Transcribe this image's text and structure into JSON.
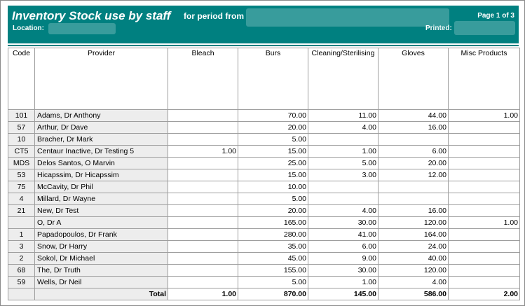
{
  "header": {
    "title": "Inventory Stock use by staff",
    "period_label": "for period from",
    "page_label": "Page 1 of 3",
    "location_label": "Location:",
    "printed_label": "Printed:"
  },
  "table": {
    "columns": [
      "Code",
      "Provider",
      "Bleach",
      "Burs",
      "Cleaning/Sterilising",
      "Gloves",
      "Misc Products"
    ],
    "rows": [
      {
        "code": "101",
        "provider": "Adams, Dr Anthony",
        "bleach": "",
        "burs": "70.00",
        "cleaning": "11.00",
        "gloves": "44.00",
        "misc": "1.00"
      },
      {
        "code": "57",
        "provider": "Arthur, Dr Dave",
        "bleach": "",
        "burs": "20.00",
        "cleaning": "4.00",
        "gloves": "16.00",
        "misc": ""
      },
      {
        "code": "10",
        "provider": "Bracher, Dr Mark",
        "bleach": "",
        "burs": "5.00",
        "cleaning": "",
        "gloves": "",
        "misc": ""
      },
      {
        "code": "CT5",
        "provider": "Centaur Inactive, Dr Testing  5",
        "bleach": "1.00",
        "burs": "15.00",
        "cleaning": "1.00",
        "gloves": "6.00",
        "misc": ""
      },
      {
        "code": "MDS",
        "provider": "Delos Santos, O Marvin",
        "bleach": "",
        "burs": "25.00",
        "cleaning": "5.00",
        "gloves": "20.00",
        "misc": ""
      },
      {
        "code": "53",
        "provider": "Hicapssim, Dr Hicapssim",
        "bleach": "",
        "burs": "15.00",
        "cleaning": "3.00",
        "gloves": "12.00",
        "misc": ""
      },
      {
        "code": "75",
        "provider": "McCavity, Dr Phil",
        "bleach": "",
        "burs": "10.00",
        "cleaning": "",
        "gloves": "",
        "misc": ""
      },
      {
        "code": "4",
        "provider": "Millard, Dr Wayne",
        "bleach": "",
        "burs": "5.00",
        "cleaning": "",
        "gloves": "",
        "misc": ""
      },
      {
        "code": "21",
        "provider": "New, Dr Test",
        "bleach": "",
        "burs": "20.00",
        "cleaning": "4.00",
        "gloves": "16.00",
        "misc": ""
      },
      {
        "code": "",
        "provider": "O, Dr A",
        "bleach": "",
        "burs": "165.00",
        "cleaning": "30.00",
        "gloves": "120.00",
        "misc": "1.00"
      },
      {
        "code": "1",
        "provider": "Papadopoulos, Dr Frank",
        "bleach": "",
        "burs": "280.00",
        "cleaning": "41.00",
        "gloves": "164.00",
        "misc": ""
      },
      {
        "code": "3",
        "provider": "Snow, Dr Harry",
        "bleach": "",
        "burs": "35.00",
        "cleaning": "6.00",
        "gloves": "24.00",
        "misc": ""
      },
      {
        "code": "2",
        "provider": "Sokol, Dr Michael",
        "bleach": "",
        "burs": "45.00",
        "cleaning": "9.00",
        "gloves": "40.00",
        "misc": ""
      },
      {
        "code": "68",
        "provider": "The, Dr Truth",
        "bleach": "",
        "burs": "155.00",
        "cleaning": "30.00",
        "gloves": "120.00",
        "misc": ""
      },
      {
        "code": "59",
        "provider": "Wells, Dr Neil",
        "bleach": "",
        "burs": "5.00",
        "cleaning": "1.00",
        "gloves": "4.00",
        "misc": ""
      }
    ],
    "total": {
      "label": "Total",
      "bleach": "1.00",
      "burs": "870.00",
      "cleaning": "145.00",
      "gloves": "586.00",
      "misc": "2.00"
    }
  }
}
